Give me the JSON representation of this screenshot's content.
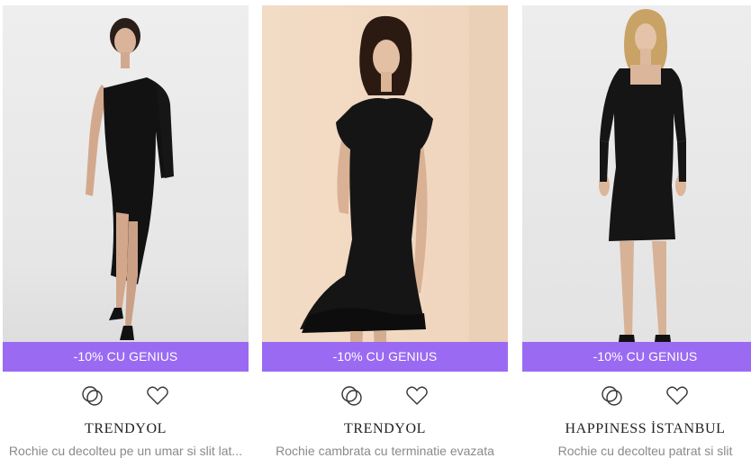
{
  "products": [
    {
      "promo": "-10% CU GENIUS",
      "brand": "TRENDYOL",
      "name": "Rochie cu decolteu pe un umar si slit lat...",
      "compare_icon": "compare-rings-icon",
      "favorite_icon": "heart-outline-icon"
    },
    {
      "promo": "-10% CU GENIUS",
      "brand": "TRENDYOL",
      "name": "Rochie cambrata cu terminatie evazata",
      "compare_icon": "compare-rings-icon",
      "favorite_icon": "heart-outline-icon"
    },
    {
      "promo": "-10% CU GENIUS",
      "brand": "HAPPINESS İSTANBUL",
      "name": "Rochie cu decolteu patrat si slit",
      "compare_icon": "compare-rings-icon",
      "favorite_icon": "heart-outline-icon"
    }
  ],
  "colors": {
    "promo_bg": "#9b6af2",
    "brand_text": "#222222",
    "name_text": "#8a8a8a"
  }
}
